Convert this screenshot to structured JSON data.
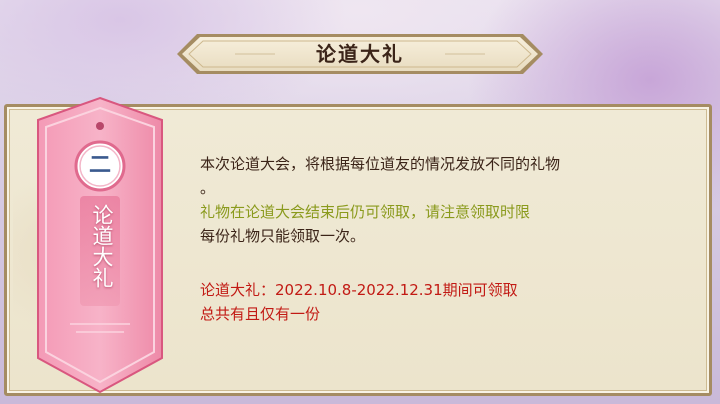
{
  "title": "论道大礼",
  "tag": {
    "number": "二",
    "label": "论道大礼"
  },
  "content": {
    "line1": "本次论道大会，将根据每位道友的情况发放不同的礼物",
    "line1_cont": "。",
    "line2": "礼物在论道大会结束后仍可领取，请注意领取时限",
    "line3": "每份礼物只能领取一次。",
    "line4": "论道大礼：2022.10.8-2022.12.31期间可领取",
    "line5": "总共有且仅有一份"
  },
  "colors": {
    "body_text": "#3b2418",
    "notice_text": "#8a9a1c",
    "highlight_text": "#c21a14",
    "ribbon_pink": "#f08aa8",
    "panel_bg": "#ece4cc"
  }
}
